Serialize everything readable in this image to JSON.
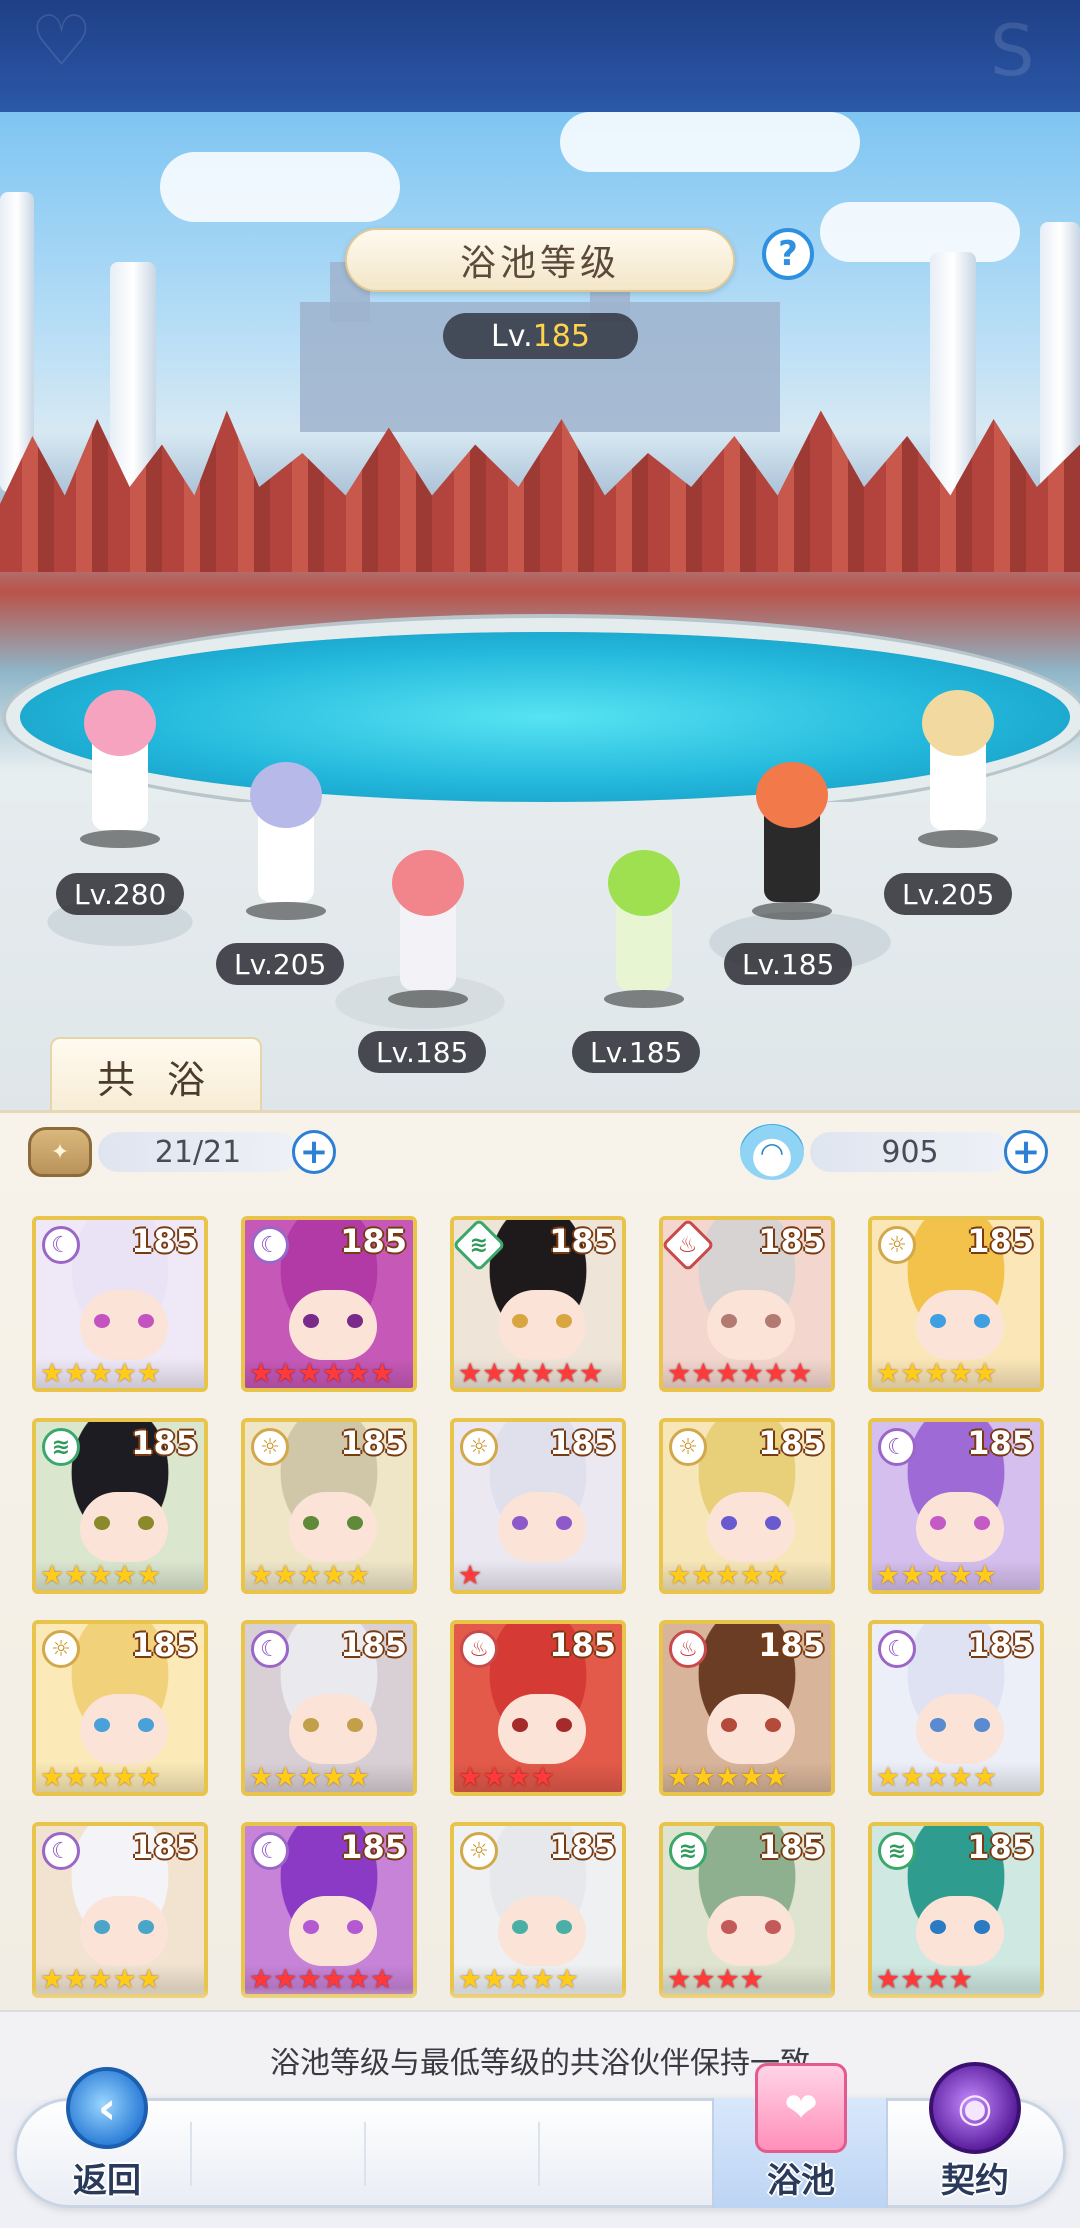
{
  "header": {
    "title": "浴池等级",
    "level_prefix": "Lv.",
    "level_value": "185",
    "help_symbol": "?"
  },
  "scene_characters": [
    {
      "level": "Lv.280",
      "hair": "#f5a3bf",
      "outfit": "#ffffff"
    },
    {
      "level": "Lv.205",
      "hair": "#b7b9e8",
      "outfit": "#ffffff"
    },
    {
      "level": "Lv.185",
      "hair": "#f2858c",
      "outfit": "#f3f3f7"
    },
    {
      "level": "Lv.185",
      "hair": "#9ee04f",
      "outfit": "#e8f5d2"
    },
    {
      "level": "Lv.185",
      "hair": "#f2794a",
      "outfit": "#2a2a2a"
    },
    {
      "level": "Lv.205",
      "hair": "#f1d9a0",
      "outfit": "#ffffff"
    }
  ],
  "tab": {
    "label": "共 浴"
  },
  "stats": {
    "partners": "21/21",
    "partners_icon": "bag-icon",
    "currency": "905",
    "currency_icon": "bunny-icon",
    "plus_symbol": "+"
  },
  "partners": [
    {
      "level": "185",
      "element": "moon",
      "stars_gold": 5,
      "stars_red": 0,
      "bg": "#efe9f7",
      "hair": "#e9e3f5",
      "eye": "#c453c2"
    },
    {
      "level": "185",
      "element": "moon",
      "stars_gold": 0,
      "stars_red": 6,
      "bg": "#c659b8",
      "hair": "#b13aa6",
      "eye": "#7a2a8a"
    },
    {
      "level": "185",
      "element": "wind",
      "stars_gold": 0,
      "stars_red": 6,
      "bg": "#efe4d8",
      "hair": "#1e1a1c",
      "eye": "#d8a640"
    },
    {
      "level": "185",
      "element": "fire",
      "stars_gold": 0,
      "stars_red": 6,
      "bg": "#f3d7cf",
      "hair": "#d7d3d3",
      "eye": "#b37a72"
    },
    {
      "level": "185",
      "element": "sun",
      "stars_gold": 5,
      "stars_red": 0,
      "bg": "#fbe6b8",
      "hair": "#f2c24a",
      "eye": "#3ea0e0"
    },
    {
      "level": "185",
      "element": "wind",
      "stars_gold": 5,
      "stars_red": 0,
      "bg": "#dbe6cf",
      "hair": "#1c1c22",
      "eye": "#8a8a2a"
    },
    {
      "level": "185",
      "element": "sun",
      "stars_gold": 5,
      "stars_red": 0,
      "bg": "#efe6c8",
      "hair": "#cfc7a8",
      "eye": "#5f8a3a"
    },
    {
      "level": "185",
      "element": "sun",
      "stars_gold": 0,
      "stars_red": 1,
      "bg": "#ebe8f2",
      "hair": "#dfe0ec",
      "eye": "#8e5ac9"
    },
    {
      "level": "185",
      "element": "sun",
      "stars_gold": 5,
      "stars_red": 0,
      "bg": "#f6e6b8",
      "hair": "#e8cf7a",
      "eye": "#6a5ad0"
    },
    {
      "level": "185",
      "element": "moon",
      "stars_gold": 5,
      "stars_red": 0,
      "bg": "#d5bfee",
      "hair": "#9d6ad6",
      "eye": "#c35ac6"
    },
    {
      "level": "185",
      "element": "sun",
      "stars_gold": 5,
      "stars_red": 0,
      "bg": "#fbeab8",
      "hair": "#f1d27a",
      "eye": "#4aa0d8"
    },
    {
      "level": "185",
      "element": "moon",
      "stars_gold": 5,
      "stars_red": 0,
      "bg": "#d9d0d6",
      "hair": "#e9e9ee",
      "eye": "#c2a04a"
    },
    {
      "level": "185",
      "element": "fire",
      "stars_gold": 0,
      "stars_red": 4,
      "bg": "#e35a4a",
      "hair": "#d63a34",
      "eye": "#a52a2a"
    },
    {
      "level": "185",
      "element": "fire",
      "stars_gold": 5,
      "stars_red": 0,
      "bg": "#d8b59a",
      "hair": "#6a3d24",
      "eye": "#b34a3a"
    },
    {
      "level": "185",
      "element": "moon",
      "stars_gold": 5,
      "stars_red": 0,
      "bg": "#eceef8",
      "hair": "#dfe2f2",
      "eye": "#5a8ad0"
    },
    {
      "level": "185",
      "element": "moon",
      "stars_gold": 5,
      "stars_red": 0,
      "bg": "#f1e3d0",
      "hair": "#f4f4f8",
      "eye": "#4aa6c9"
    },
    {
      "level": "185",
      "element": "moon",
      "stars_gold": 0,
      "stars_red": 6,
      "bg": "#c783d8",
      "hair": "#8a3ac4",
      "eye": "#b35ad2"
    },
    {
      "level": "185",
      "element": "sun",
      "stars_gold": 5,
      "stars_red": 0,
      "bg": "#eef0f2",
      "hair": "#e6e8ec",
      "eye": "#4ab0a6"
    },
    {
      "level": "185",
      "element": "wind",
      "stars_gold": 0,
      "stars_red": 4,
      "bg": "#dfe4d0",
      "hair": "#8fb08f",
      "eye": "#c35a5a"
    },
    {
      "level": "185",
      "element": "wind",
      "stars_gold": 0,
      "stars_red": 4,
      "bg": "#cfe8e2",
      "hair": "#2f9c90",
      "eye": "#2a7ac4"
    }
  ],
  "footer": {
    "note": "浴池等级与最低等级的共浴伙伴保持一致"
  },
  "nav": {
    "back_label": "返回",
    "back_icon": "back-arrow-icon",
    "pool_label": "浴池",
    "pool_icon": "gift-box-icon",
    "contract_label": "契约",
    "contract_icon": "contract-orb-icon"
  },
  "colors": {
    "accent_blue": "#2d7fd6",
    "card_gold": "#e8c44a",
    "star_gold": "#ffcc1a",
    "star_red": "#ff3a3a"
  }
}
